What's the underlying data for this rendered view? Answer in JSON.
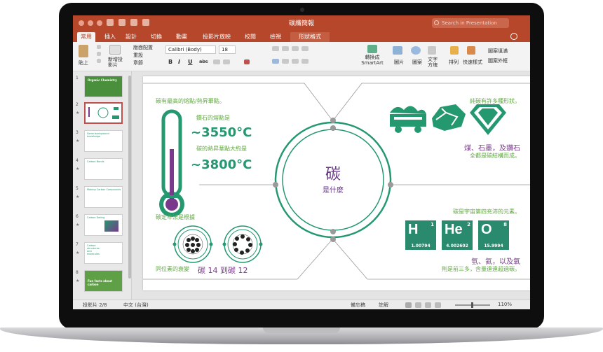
{
  "window": {
    "title": "碳纖簡報",
    "search_placeholder": "Search in Presentation"
  },
  "tabs": [
    "常用",
    "插入",
    "設計",
    "切換",
    "動畫",
    "投影片放映",
    "校閱",
    "檢視",
    "形狀格式"
  ],
  "ribbon": {
    "paste": "貼上",
    "new_slide": "新增投\n影片",
    "layout": "版面配置",
    "reset": "重設",
    "section": "章節",
    "font_name": "Calibri (Body)",
    "font_size": "18",
    "bold": "B",
    "italic": "I",
    "underline": "U",
    "strike": "abc",
    "convert_smartart": "轉換成\nSmartArt",
    "picture": "圖片",
    "shapes": "圖案",
    "textbox": "文字\n方塊",
    "arrange": "排列",
    "quick_styles": "快速樣式",
    "shape_fill": "圖案填滿",
    "shape_outline": "圖案外框"
  },
  "thumbnails": {
    "numbers": [
      "1",
      "2",
      "3",
      "4",
      "5",
      "6",
      "7",
      "8"
    ],
    "t1": "Organic Chemistry",
    "t3": "Some background knowledge",
    "t4": "Carbon Bonds",
    "t5": "Making Carbon Compounds",
    "t6": "Carbon Dating",
    "t7": "Carbon structures and molecules",
    "t8": "Fun facts about carbon"
  },
  "slide": {
    "center_title": "碳",
    "center_sub": "是什麼",
    "tl_caption": "碳有最高的熔點/熱昇華點。",
    "diamond_label": "鑽石的熔點是",
    "temp1": "~3550°C",
    "sublimation_label": "碳的熱昇華點大約是",
    "temp2": "~3800°C",
    "bl_caption": "碳定年法是根據",
    "isotopes_prefix": "同位素的衰變",
    "isotopes": "碳 14 到碳 12",
    "tr_caption": "純碳有許多種形狀。",
    "forms": "煤、石墨，及鑽石",
    "forms_sub": "全都是碳結構而成。",
    "br_caption": "碳是宇宙第四充沛的元素。",
    "elements_line": "氫、氦，以及氧",
    "elements_sub": "則是前三多，含量遠遠超過碳。",
    "elements": [
      {
        "sym": "H",
        "num": "1",
        "mass": "1.00794"
      },
      {
        "sym": "He",
        "num": "2",
        "mass": "4.002602"
      },
      {
        "sym": "O",
        "num": "8",
        "mass": "15.9994"
      }
    ]
  },
  "status": {
    "slide_count": "投影片 2/8",
    "language": "中文 (台灣)",
    "notes": "備忘稿",
    "comments": "註解",
    "zoom": "110%"
  },
  "colors": {
    "ppt_red": "#b7472a",
    "teal": "#24986f",
    "green_text": "#5eaa3c",
    "purple": "#7a3a8c"
  }
}
